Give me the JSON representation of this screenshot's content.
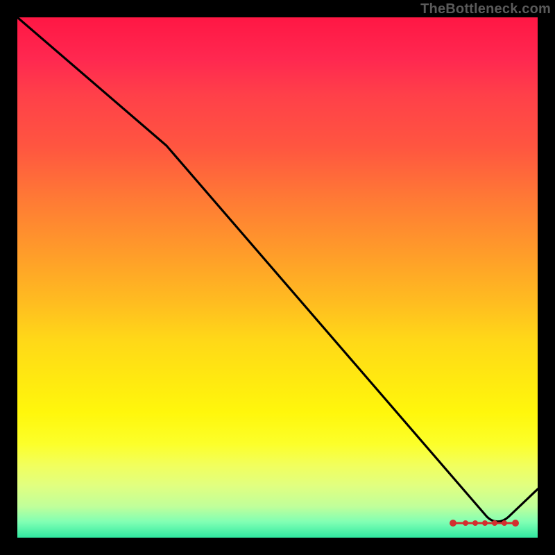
{
  "watermark": "TheBottleneck.com",
  "colors": {
    "top": "#ff1744",
    "mid": "#ffd818",
    "bottom": "#30e8a0",
    "curve": "#000000",
    "marker": "#d32f2f",
    "frame": "#000000"
  },
  "chart_data": {
    "type": "line",
    "title": "",
    "xlabel": "",
    "ylabel": "",
    "xlim": [
      0,
      100
    ],
    "ylim": [
      0,
      100
    ],
    "grid": false,
    "legend": false,
    "series": [
      {
        "name": "bottleneck-curve",
        "x": [
          0,
          29,
          90,
          94,
          100
        ],
        "y": [
          100,
          75,
          4,
          3,
          9
        ]
      }
    ],
    "markers": {
      "name": "optimal-band",
      "x": [
        84,
        86,
        88,
        90,
        92,
        94,
        96
      ],
      "y": [
        3,
        3,
        3,
        3,
        3,
        3,
        3
      ]
    },
    "background_gradient": {
      "direction": "vertical",
      "stops": [
        {
          "pos": 0.0,
          "color": "#ff1744"
        },
        {
          "pos": 0.5,
          "color": "#ffbd20"
        },
        {
          "pos": 0.8,
          "color": "#fcff2a"
        },
        {
          "pos": 1.0,
          "color": "#30e8a0"
        }
      ]
    }
  }
}
